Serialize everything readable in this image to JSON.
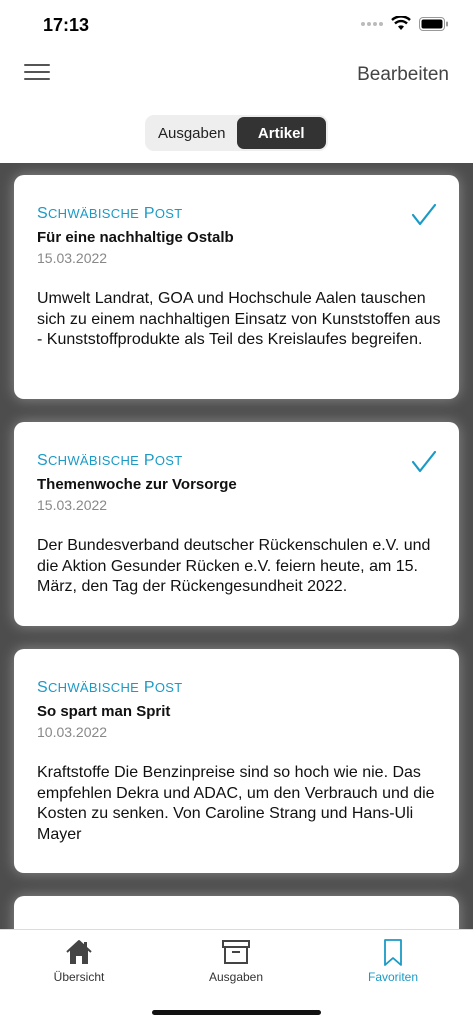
{
  "status": {
    "time": "17:13"
  },
  "nav": {
    "edit_label": "Bearbeiten"
  },
  "segments": [
    {
      "label": "Ausgaben",
      "active": false
    },
    {
      "label": "Artikel",
      "active": true
    }
  ],
  "articles": [
    {
      "source": "Schwäbische Post",
      "title": "Für eine nachhaltige Ostalb",
      "date": "15.03.2022",
      "text": "Umwelt Landrat, GOA und Hochschule Aalen tauschen sich zu einem nachhaltigen Einsatz von Kunststoffen aus - Kunststoffprodukte als Teil des Kreislaufes begreifen.",
      "checked": true
    },
    {
      "source": "Schwäbische Post",
      "title": "Themenwoche zur Vorsorge",
      "date": "15.03.2022",
      "text": "Der Bundesverband deutscher Rückenschulen e.V. und die Aktion Gesunder Rücken e.V. feiern heute, am 15. März, den Tag der Rückengesundheit 2022.",
      "checked": true
    },
    {
      "source": "Schwäbische Post",
      "title": "So spart man Sprit",
      "date": "10.03.2022",
      "text": "Kraftstoffe Die Benzinpreise sind so hoch wie nie. Das empfehlen Dekra und ADAC, um den Verbrauch und die Kosten zu senken. Von Caroline Strang und Hans-Uli Mayer",
      "checked": false
    }
  ],
  "tabs": [
    {
      "label": "Übersicht",
      "icon": "home-icon",
      "active": false
    },
    {
      "label": "Ausgaben",
      "icon": "archive-box-icon",
      "active": false
    },
    {
      "label": "Favoriten",
      "icon": "bookmark-icon",
      "active": true
    }
  ],
  "colors": {
    "accent": "#1b9ac6",
    "segment_active": "#333333",
    "content_bg": "#4d4d4d"
  }
}
